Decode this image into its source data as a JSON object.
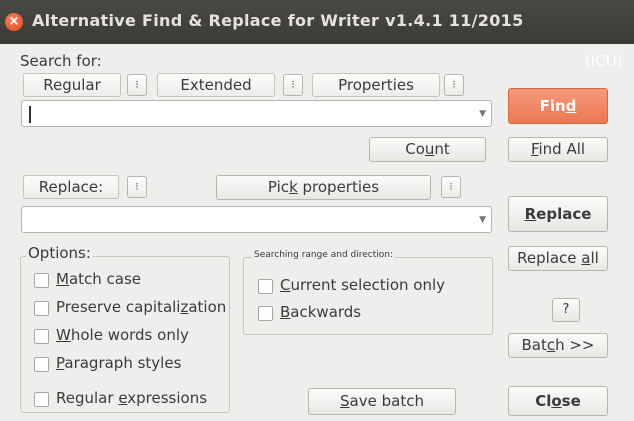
{
  "window": {
    "title": "Alternative Find & Replace for Writer  v1.4.1  11/2015",
    "close_glyph": "×"
  },
  "search": {
    "label": "Search for:",
    "icu": "(ICU)",
    "mode_regular": "Regular",
    "mode_extended": "Extended",
    "mode_properties": "Properties",
    "value": "",
    "dropdown_glyph": "▼"
  },
  "buttons": {
    "find": [
      "Fin",
      "d",
      ""
    ],
    "count": [
      "Co",
      "u",
      "nt"
    ],
    "find_all": [
      "",
      "F",
      "ind All"
    ],
    "replace": [
      "",
      "R",
      "eplace"
    ],
    "replace_all": [
      "Replace ",
      "a",
      "ll"
    ],
    "help": "?",
    "batch": [
      "Bat",
      "c",
      "h >>"
    ],
    "save_batch": [
      "",
      "S",
      "ave batch"
    ],
    "close": [
      "Cl",
      "o",
      "se"
    ]
  },
  "replace": {
    "label": "Replace:",
    "pick_properties": [
      "Pic",
      "k",
      " properties"
    ],
    "value": "",
    "dropdown_glyph": "▼"
  },
  "spin_glyph": "⁝",
  "options": {
    "title": "Options:",
    "items": [
      [
        "",
        "M",
        "atch case"
      ],
      [
        "Preserve capitali",
        "z",
        "ation"
      ],
      [
        "",
        "W",
        "hole words only"
      ],
      [
        "",
        "P",
        "aragraph styles"
      ],
      [
        "Regular ",
        "e",
        "xpressions"
      ]
    ]
  },
  "range": {
    "title": "Searching range and direction:",
    "items": [
      [
        "",
        "C",
        "urrent selection only"
      ],
      [
        "",
        "B",
        "ackwards"
      ]
    ]
  }
}
